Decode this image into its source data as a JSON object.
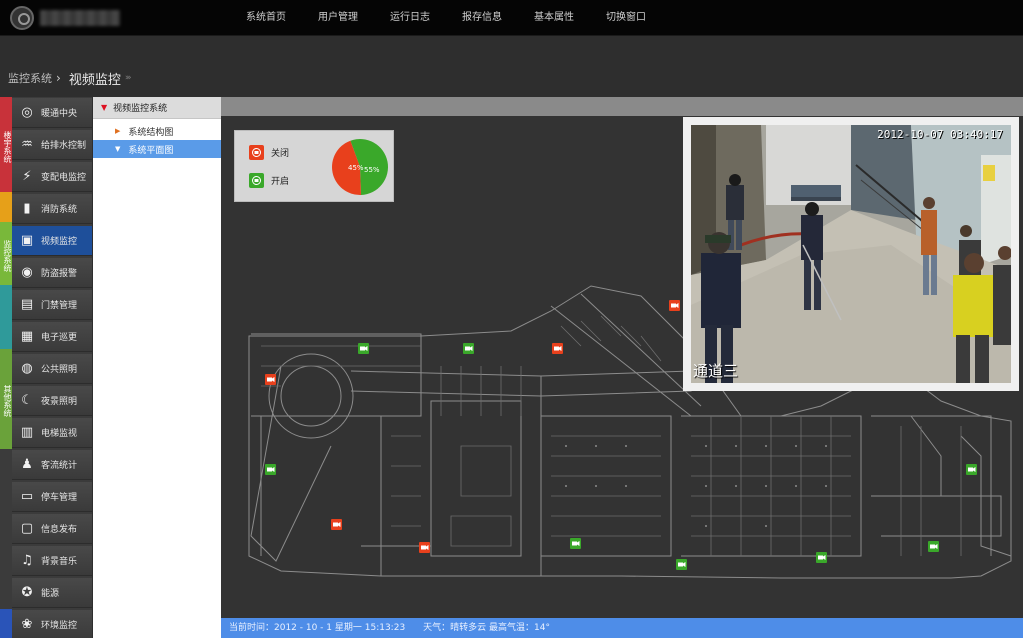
{
  "nav": {
    "items": [
      "系统首页",
      "用户管理",
      "运行日志",
      "报存信息",
      "基本属性",
      "切换窗口"
    ]
  },
  "breadcrumb": {
    "root": "监控系统",
    "current": "视频监控"
  },
  "categories": [
    "楼宇系统",
    "监控系统",
    "其他系统"
  ],
  "colors": {
    "accent": "#1e4f9a",
    "status_bar": "#4e8de8",
    "closed_red": "#e8401c",
    "open_green": "#3aa82a"
  },
  "menu": {
    "items": [
      {
        "label": "暖通中央",
        "icon": "hvac-icon"
      },
      {
        "label": "给排水控制",
        "icon": "water-drop-icon"
      },
      {
        "label": "变配电监控",
        "icon": "power-icon"
      },
      {
        "label": "消防系统",
        "icon": "fire-extinguisher-icon"
      },
      {
        "label": "视频监控",
        "icon": "camera-icon"
      },
      {
        "label": "防盗报警",
        "icon": "alarm-icon"
      },
      {
        "label": "门禁管理",
        "icon": "door-icon"
      },
      {
        "label": "电子巡更",
        "icon": "patrol-icon"
      },
      {
        "label": "公共照明",
        "icon": "bulb-icon"
      },
      {
        "label": "夜景照明",
        "icon": "moon-icon"
      },
      {
        "label": "电梯监视",
        "icon": "elevator-icon"
      },
      {
        "label": "客流统计",
        "icon": "people-icon"
      },
      {
        "label": "停车管理",
        "icon": "parking-icon"
      },
      {
        "label": "信息发布",
        "icon": "monitor-icon"
      },
      {
        "label": "背景音乐",
        "icon": "music-icon"
      },
      {
        "label": "能源",
        "icon": "energy-icon"
      },
      {
        "label": "环境监控",
        "icon": "environment-icon"
      }
    ],
    "active_index": 4
  },
  "tree": {
    "root": "视频监控系统",
    "nodes": [
      "系统结构图",
      "系统平面图"
    ],
    "selected_index": 1
  },
  "legend": {
    "closed_label": "关闭",
    "open_label": "开启",
    "closed_pct": "45%",
    "open_pct": "55%",
    "closed_value": 45,
    "open_value": 55
  },
  "camera_feed": {
    "timestamp": "2012-10-07 03:40:17",
    "channel": "通道三"
  },
  "status": {
    "time_label": "当前时间：2012 - 10 - 1 星期一 15:13:23",
    "weather": "天气：晴转多云 最高气温：14°"
  },
  "cameras": [
    {
      "state": "open"
    },
    {
      "state": "open"
    },
    {
      "state": "closed"
    },
    {
      "state": "closed"
    },
    {
      "state": "closed"
    },
    {
      "state": "open"
    },
    {
      "state": "closed"
    },
    {
      "state": "closed"
    },
    {
      "state": "open"
    },
    {
      "state": "open"
    },
    {
      "state": "open"
    },
    {
      "state": "open"
    },
    {
      "state": "open"
    }
  ]
}
